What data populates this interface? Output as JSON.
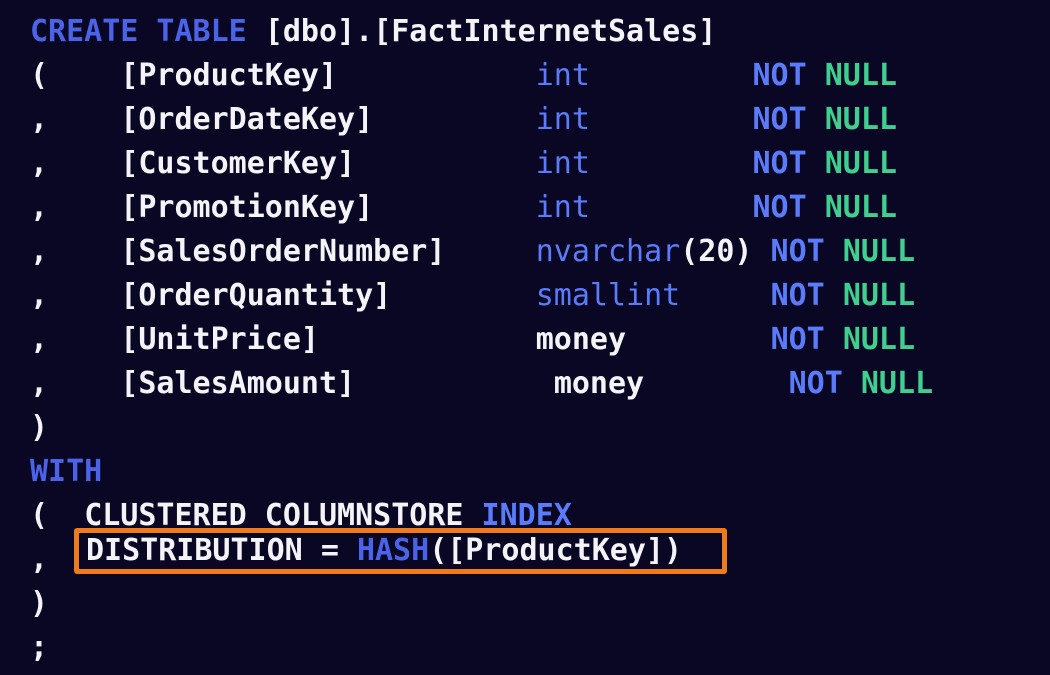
{
  "editor": {
    "background_color": "#0a0724",
    "default_text_color": "#f2f2f7",
    "language": "T-SQL",
    "font_size_px": 30,
    "line_height_px": 44
  },
  "colors": {
    "keyword_blue": "#4a63e8",
    "type_blue": "#5b7cfa",
    "null_green": "#3fcf8e",
    "identifier_white": "#f4f4f8",
    "highlight_orange": "#ef7c1b",
    "background": "#0a0724"
  },
  "statement": {
    "header": {
      "keyword": "CREATE TABLE",
      "schema": "[dbo]",
      "dot": ".",
      "table": "[FactInternetSales]"
    },
    "open_paren": "(",
    "close_paren": ")",
    "with_keyword": "WITH",
    "with_open_paren": "(",
    "with_close_paren": ")",
    "terminator": ";",
    "columns": [
      {
        "lead": "(",
        "name": "[ProductKey]",
        "type": "int",
        "type_arg": "",
        "type_style": "blue",
        "nullability_not": "NOT",
        "nullability_null": "NULL"
      },
      {
        "lead": ",",
        "name": "[OrderDateKey]",
        "type": "int",
        "type_arg": "",
        "type_style": "blue",
        "nullability_not": "NOT",
        "nullability_null": "NULL"
      },
      {
        "lead": ",",
        "name": "[CustomerKey]",
        "type": "int",
        "type_arg": "",
        "type_style": "blue",
        "nullability_not": "NOT",
        "nullability_null": "NULL"
      },
      {
        "lead": ",",
        "name": "[PromotionKey]",
        "type": "int",
        "type_arg": "",
        "type_style": "blue",
        "nullability_not": "NOT",
        "nullability_null": "NULL"
      },
      {
        "lead": ",",
        "name": "[SalesOrderNumber]",
        "type": "nvarchar",
        "type_arg": "(20)",
        "type_style": "blue",
        "nullability_not": "NOT",
        "nullability_null": "NULL"
      },
      {
        "lead": ",",
        "name": "[OrderQuantity]",
        "type": "smallint",
        "type_arg": "",
        "type_style": "blue",
        "nullability_not": "NOT",
        "nullability_null": "NULL"
      },
      {
        "lead": ",",
        "name": "[UnitPrice]",
        "type": "money",
        "type_arg": "",
        "type_style": "white",
        "nullability_not": "NOT",
        "nullability_null": "NULL"
      },
      {
        "lead": ",",
        "name": "[SalesAmount]",
        "type": "money",
        "type_arg": "",
        "type_style": "white",
        "nullability_not": "NOT",
        "nullability_null": "NULL"
      }
    ],
    "with_options": [
      {
        "lead": "(",
        "text_pre": "CLUSTERED COLUMNSTORE ",
        "keyword": "INDEX",
        "text_post": ""
      },
      {
        "lead": ",",
        "option_name": "DISTRIBUTION",
        "equals": "=",
        "function": "HASH",
        "open": "(",
        "argument": "[ProductKey]",
        "close": ")",
        "highlighted": true
      }
    ]
  },
  "annotation": {
    "highlight_label": "distribution-clause-highlight",
    "highlight_color": "#ef7c1b",
    "highlight_border_px": 5
  }
}
